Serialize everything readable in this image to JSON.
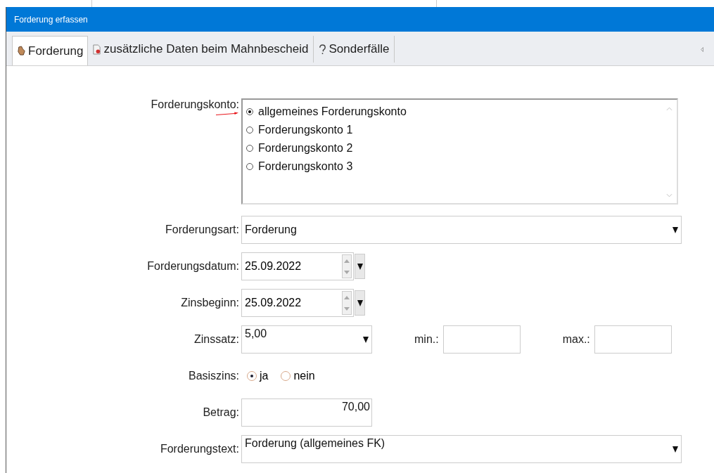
{
  "window": {
    "title": "Forderung erfassen"
  },
  "tabs": [
    {
      "label": "Forderung",
      "selected": true
    },
    {
      "label": "zusätzliche Daten beim Mahnbescheid",
      "selected": false
    },
    {
      "label": "Sonderfälle",
      "selected": false
    }
  ],
  "form": {
    "konto": {
      "label": "Forderungskonto:",
      "options": [
        {
          "label": "allgemeines Forderungskonto",
          "selected": true
        },
        {
          "label": "Forderungskonto 1",
          "selected": false
        },
        {
          "label": "Forderungskonto 2",
          "selected": false
        },
        {
          "label": "Forderungskonto 3",
          "selected": false
        }
      ]
    },
    "art": {
      "label": "Forderungsart:",
      "value": "Forderung"
    },
    "datum": {
      "label": "Forderungsdatum:",
      "value": "25.09.2022"
    },
    "zinsbeginn": {
      "label": "Zinsbeginn:",
      "value": "25.09.2022"
    },
    "zinssatz": {
      "label": "Zinssatz:",
      "value": "5,00",
      "min_label": "min.:",
      "max_label": "max.:"
    },
    "basiszins": {
      "label": "Basiszins:",
      "options": [
        {
          "label": "ja",
          "selected": true
        },
        {
          "label": "nein",
          "selected": false
        }
      ]
    },
    "betrag": {
      "label": "Betrag:",
      "value": "70,00"
    },
    "text": {
      "label": "Forderungstext:",
      "value": "Forderung (allgemeines FK)"
    }
  }
}
